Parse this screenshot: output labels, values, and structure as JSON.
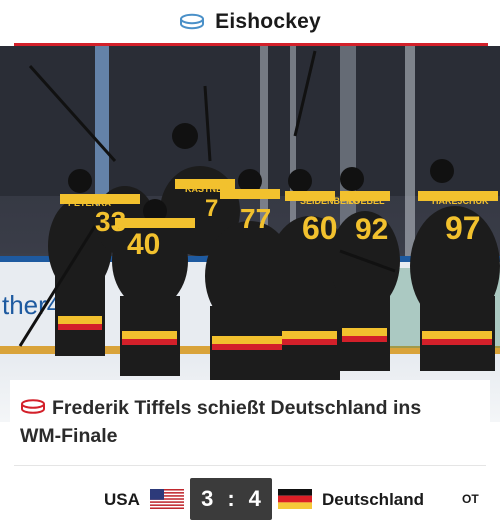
{
  "header": {
    "title": "Eishockey",
    "icon": "hockey-puck-icon",
    "accent_color": "#d3202a",
    "icon_color": "#4a90c8"
  },
  "hero": {
    "jerseys": [
      {
        "number": "40",
        "name": "EHL"
      },
      {
        "number": "60",
        "name": "SEIDENBERG"
      },
      {
        "number": "92",
        "name": "LOEBEL"
      },
      {
        "number": "97",
        "name": "HAREJCHUK"
      },
      {
        "number": "77",
        "name": "ABAUCH"
      },
      {
        "number": "33",
        "name": "PETERKA"
      },
      {
        "number": "7",
        "name": "KASTNER"
      }
    ],
    "board_text": "ther4",
    "jersey_color": "#1c1c1c",
    "number_color": "#f2c12e"
  },
  "article": {
    "headline": "Frederik Tiffels schießt Deutschland ins WM-Finale",
    "icon": "hockey-puck-icon",
    "icon_color": "#d3202a"
  },
  "score": {
    "home_team": "USA",
    "home_flag": "usa-flag-icon",
    "home_score": "3",
    "separator": ":",
    "away_score": "4",
    "away_team": "Deutschland",
    "away_flag": "germany-flag-icon",
    "status": "OT"
  }
}
